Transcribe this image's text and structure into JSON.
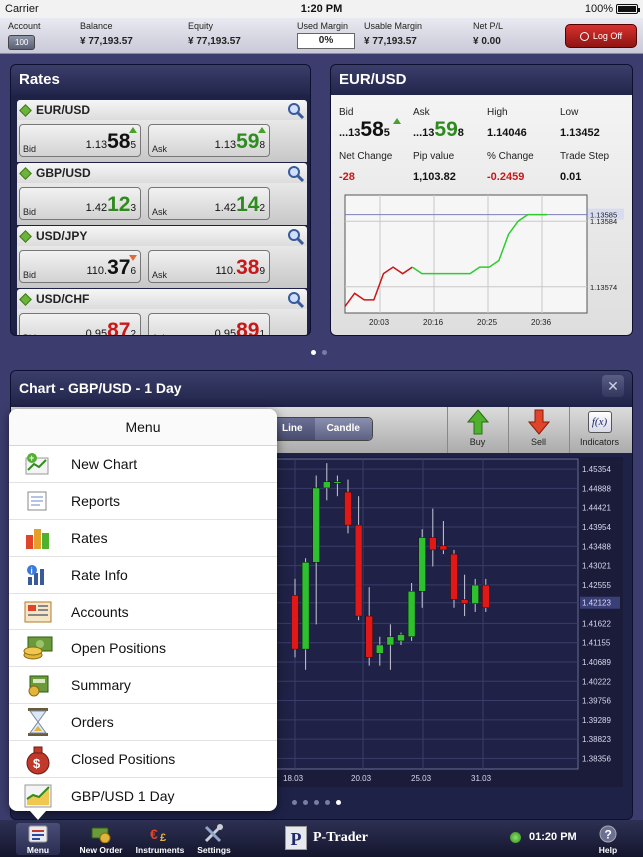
{
  "status_bar": {
    "carrier": "Carrier",
    "time": "1:20 PM",
    "battery": "100%"
  },
  "account_bar": {
    "account_label": "Account",
    "account_value": "100",
    "balance_label": "Balance",
    "balance_value": "¥ 77,193.57",
    "equity_label": "Equity",
    "equity_value": "¥ 77,193.57",
    "used_margin_label": "Used Margin",
    "used_margin_value": "0%",
    "usable_margin_label": "Usable Margin",
    "usable_margin_value": "¥ 77,193.57",
    "net_pl_label": "Net P/L",
    "net_pl_value": "¥ 0.00",
    "logoff_label": "Log Off"
  },
  "rates": {
    "title": "Rates",
    "bid_label": "Bid",
    "ask_label": "Ask",
    "pairs": [
      {
        "name": "EUR/USD",
        "bid_pre": "1.13",
        "bid_big": "58",
        "bid_sm": "5",
        "bid_dir": "plain",
        "ask_pre": "1.13",
        "ask_big": "59",
        "ask_sm": "8",
        "ask_dir": "up",
        "trend": "up"
      },
      {
        "name": "GBP/USD",
        "bid_pre": "1.42",
        "bid_big": "12",
        "bid_sm": "3",
        "bid_dir": "up",
        "ask_pre": "1.42",
        "ask_big": "14",
        "ask_sm": "2",
        "ask_dir": "up",
        "trend": "none"
      },
      {
        "name": "USD/JPY",
        "bid_pre": "110.",
        "bid_big": "37",
        "bid_sm": "6",
        "bid_dir": "plain",
        "ask_pre": "110.",
        "ask_big": "38",
        "ask_sm": "9",
        "ask_dir": "down",
        "trend": "down"
      },
      {
        "name": "USD/CHF",
        "bid_pre": "0.95",
        "bid_big": "87",
        "bid_sm": "2",
        "bid_dir": "down",
        "ask_pre": "0.95",
        "ask_big": "89",
        "ask_sm": "1",
        "ask_dir": "down",
        "trend": "none"
      }
    ]
  },
  "pair_detail": {
    "title": "EUR/USD",
    "bid_label": "Bid",
    "bid_pre": "...13",
    "bid_big": "58",
    "bid_sm": "5",
    "ask_label": "Ask",
    "ask_pre": "...13",
    "ask_big": "59",
    "ask_sm": "8",
    "high_label": "High",
    "high_value": "1.14046",
    "low_label": "Low",
    "low_value": "1.13452",
    "net_change_label": "Net Change",
    "net_change_value": "-28",
    "pip_value_label": "Pip value",
    "pip_value_value": "1,103.82",
    "pct_change_label": "% Change",
    "pct_change_value": "-0.2459",
    "trade_step_label": "Trade Step",
    "trade_step_value": "0.01"
  },
  "main_chart": {
    "title": "Chart - GBP/USD - 1 Day",
    "close_label": "✕",
    "line_label": "Line",
    "candle_label": "Candle",
    "buy_label": "Buy",
    "sell_label": "Sell",
    "indicators_label": "Indicators"
  },
  "menu": {
    "title": "Menu",
    "items": [
      {
        "label": "New Chart",
        "icon": "new-chart-icon"
      },
      {
        "label": "Reports",
        "icon": "reports-icon"
      },
      {
        "label": "Rates",
        "icon": "rates-icon"
      },
      {
        "label": "Rate Info",
        "icon": "rate-info-icon"
      },
      {
        "label": "Accounts",
        "icon": "accounts-icon"
      },
      {
        "label": "Open Positions",
        "icon": "open-positions-icon"
      },
      {
        "label": "Summary",
        "icon": "summary-icon"
      },
      {
        "label": "Orders",
        "icon": "orders-icon"
      },
      {
        "label": "Closed Positions",
        "icon": "closed-positions-icon"
      },
      {
        "label": "GBP/USD 1 Day",
        "icon": "chart-shortcut-icon"
      }
    ]
  },
  "bottom_bar": {
    "menu_label": "Menu",
    "new_order_label": "New Order",
    "instruments_label": "Instruments",
    "settings_label": "Settings",
    "brand": "P-Trader",
    "brand_letter": "P",
    "clock": "01:20 PM",
    "help_label": "Help"
  },
  "chart_data": [
    {
      "type": "line",
      "title": "EUR/USD",
      "x_ticks": [
        "20:03",
        "20:16",
        "20:25",
        "20:36"
      ],
      "y_ticks": [
        1.13585,
        1.13584,
        1.13574
      ],
      "y_range": [
        1.1357,
        1.13588
      ],
      "highlight_values": [
        1.13585
      ],
      "grid": true,
      "series": [
        {
          "color": "#c81818",
          "points": [
            [
              0,
              1.13571
            ],
            [
              1,
              1.13573
            ],
            [
              2,
              1.13572
            ],
            [
              3,
              1.13572
            ],
            [
              4,
              1.13576
            ],
            [
              5,
              1.13577
            ],
            [
              6,
              1.13576
            ],
            [
              7,
              1.13577
            ]
          ]
        },
        {
          "color": "#2ecc2e",
          "points": [
            [
              7,
              1.13577
            ],
            [
              8,
              1.13576
            ],
            [
              9,
              1.13576
            ],
            [
              10,
              1.13576
            ],
            [
              11,
              1.13576
            ],
            [
              12,
              1.13576
            ],
            [
              13,
              1.13576
            ],
            [
              14,
              1.13577
            ],
            [
              15,
              1.13577
            ],
            [
              16,
              1.13578
            ],
            [
              17,
              1.13582
            ],
            [
              18,
              1.13584
            ],
            [
              19,
              1.13585
            ],
            [
              20,
              1.13585
            ],
            [
              21,
              1.13585
            ]
          ]
        }
      ]
    },
    {
      "type": "candlestick",
      "title": "Chart - GBP/USD - 1 Day",
      "x_ticks": [
        "18.03",
        "20.03",
        "25.03",
        "31.03"
      ],
      "y_ticks": [
        1.45354,
        1.44888,
        1.44421,
        1.43954,
        1.43488,
        1.43021,
        1.42555,
        1.42123,
        1.41622,
        1.41155,
        1.40689,
        1.40222,
        1.39756,
        1.39289,
        1.38823,
        1.38356
      ],
      "y_range": [
        1.381,
        1.456
      ],
      "current_price": 1.42123,
      "grid": true,
      "candles": [
        {
          "open": 1.423,
          "high": 1.427,
          "low": 1.408,
          "close": 1.41
        },
        {
          "open": 1.41,
          "high": 1.432,
          "low": 1.405,
          "close": 1.431
        },
        {
          "open": 1.431,
          "high": 1.452,
          "low": 1.416,
          "close": 1.449
        },
        {
          "open": 1.449,
          "high": 1.455,
          "low": 1.446,
          "close": 1.4505
        },
        {
          "open": 1.4505,
          "high": 1.452,
          "low": 1.447,
          "close": 1.4505
        },
        {
          "open": 1.448,
          "high": 1.451,
          "low": 1.438,
          "close": 1.44
        },
        {
          "open": 1.44,
          "high": 1.447,
          "low": 1.417,
          "close": 1.418
        },
        {
          "open": 1.418,
          "high": 1.425,
          "low": 1.406,
          "close": 1.408
        },
        {
          "open": 1.409,
          "high": 1.413,
          "low": 1.406,
          "close": 1.411
        },
        {
          "open": 1.411,
          "high": 1.416,
          "low": 1.405,
          "close": 1.413
        },
        {
          "open": 1.412,
          "high": 1.414,
          "low": 1.411,
          "close": 1.4135
        },
        {
          "open": 1.413,
          "high": 1.426,
          "low": 1.412,
          "close": 1.424
        },
        {
          "open": 1.424,
          "high": 1.439,
          "low": 1.42,
          "close": 1.437
        },
        {
          "open": 1.437,
          "high": 1.444,
          "low": 1.43,
          "close": 1.434
        },
        {
          "open": 1.435,
          "high": 1.441,
          "low": 1.433,
          "close": 1.434
        },
        {
          "open": 1.433,
          "high": 1.434,
          "low": 1.42,
          "close": 1.422
        },
        {
          "open": 1.422,
          "high": 1.428,
          "low": 1.418,
          "close": 1.421
        },
        {
          "open": 1.421,
          "high": 1.427,
          "low": 1.419,
          "close": 1.4255
        },
        {
          "open": 1.4255,
          "high": 1.427,
          "low": 1.419,
          "close": 1.42
        }
      ]
    }
  ]
}
